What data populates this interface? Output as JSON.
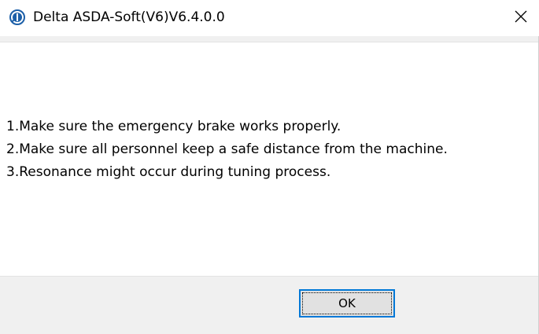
{
  "window": {
    "title": "Delta ASDA-Soft(V6)V6.4.0.0",
    "app_icon": "delta-logo-icon",
    "close_icon": "close-icon"
  },
  "message": {
    "lines": [
      "1.Make sure the emergency brake works properly.",
      "2.Make sure all personnel keep a safe distance from the machine.",
      "3.Resonance might occur during tuning process."
    ]
  },
  "buttons": {
    "ok_label": "OK"
  },
  "colors": {
    "accent": "#0078d7",
    "icon_blue": "#1c5fa8"
  }
}
